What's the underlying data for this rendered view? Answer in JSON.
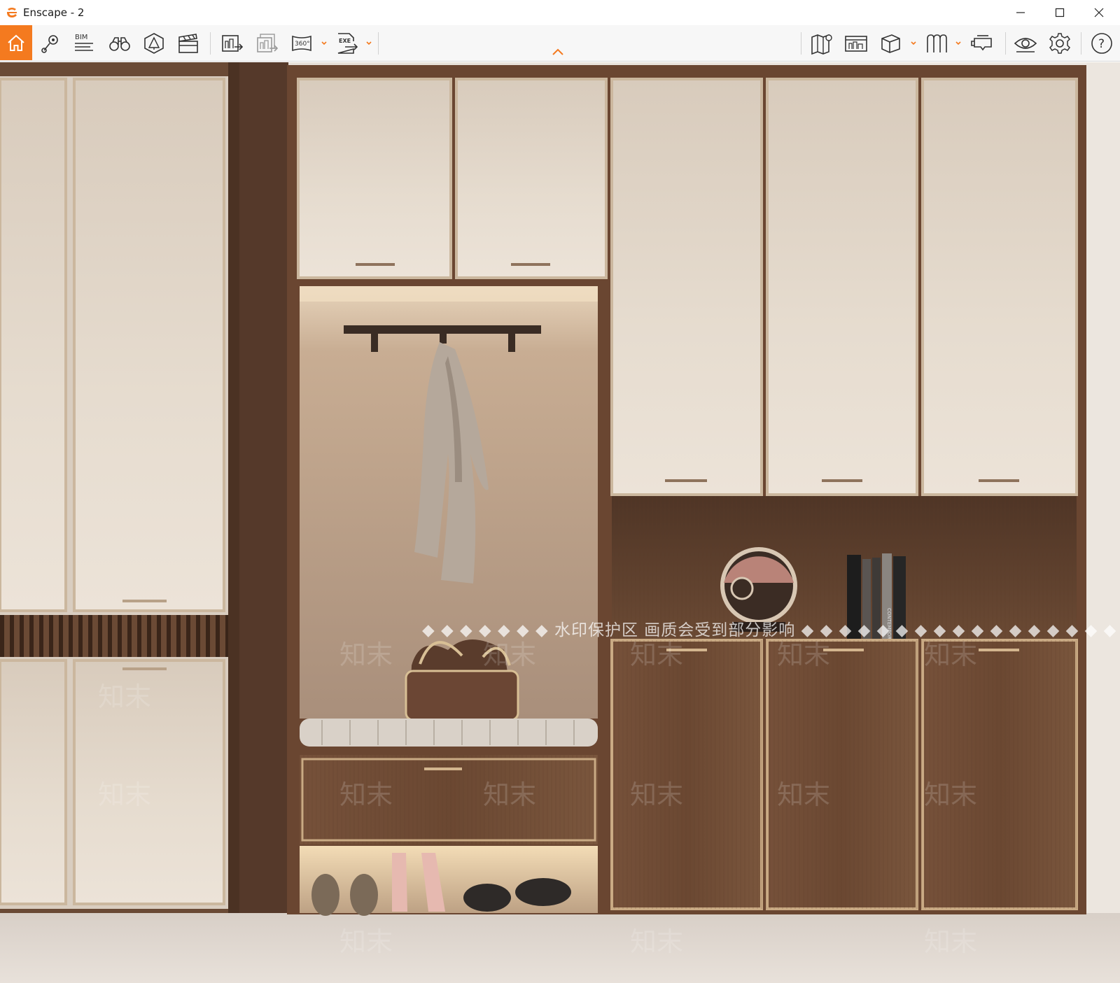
{
  "window": {
    "title": "Enscape - 2",
    "controls": [
      "minimize",
      "maximize",
      "close"
    ]
  },
  "toolbar": {
    "left_tools": [
      {
        "id": "home",
        "icon": "home-icon",
        "active": true
      },
      {
        "id": "views",
        "icon": "location-pin-icon"
      },
      {
        "id": "bim",
        "icon": "bim-icon",
        "text": "BIM"
      },
      {
        "id": "binoculars",
        "icon": "binoculars-icon"
      },
      {
        "id": "assets",
        "icon": "asset-library-icon"
      },
      {
        "id": "video",
        "icon": "clapperboard-icon"
      },
      {
        "id": "render-export",
        "icon": "render-export-icon"
      },
      {
        "id": "batch-render",
        "icon": "batch-render-icon"
      },
      {
        "id": "panorama",
        "icon": "panorama-360-icon",
        "text": "360°"
      },
      {
        "id": "exe-export",
        "icon": "exe-export-icon",
        "text": "EXE"
      }
    ],
    "right_tools": [
      {
        "id": "map",
        "icon": "map-icon"
      },
      {
        "id": "material",
        "icon": "material-editor-icon"
      },
      {
        "id": "cube",
        "icon": "cube-icon"
      },
      {
        "id": "library",
        "icon": "library-icon"
      },
      {
        "id": "vr",
        "icon": "vr-headset-icon"
      },
      {
        "id": "visual-settings",
        "icon": "eye-icon"
      },
      {
        "id": "settings",
        "icon": "gear-icon"
      },
      {
        "id": "help",
        "icon": "help-icon",
        "text": "?"
      }
    ]
  },
  "viewport": {
    "watermark_main": "◆ ◆ ◆ ◆ ◆ ◆ ◆ 水印保护区   画质会受到部分影响 ◆ ◆ ◆ ◆ ◆ ◆ ◆ ◆ ◆ ◆ ◆ ◆ ◆ ◆ ◆ ◆ ◆ ◆ ◆ ◆",
    "watermark_tile": "知末",
    "book_spine": "CONTEMPORARY ART BOOKS"
  },
  "colors": {
    "accent": "#f47a1f",
    "toolbar_bg": "#f7f7f7",
    "wall": "#e9e4de",
    "cabinet_cream": "#e6ddd1",
    "walnut": "#6e4a33",
    "dark_wood": "#4f3424"
  }
}
